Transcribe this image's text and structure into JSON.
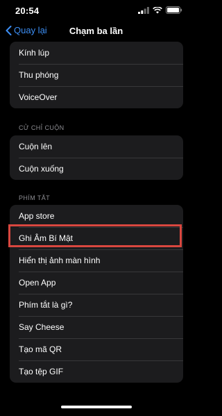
{
  "status_bar": {
    "time": "20:54"
  },
  "nav": {
    "back_label": "Quay lại",
    "title": "Chạm ba lần"
  },
  "sections": {
    "top": {
      "items": [
        "Kính lúp",
        "Thu phóng",
        "VoiceOver"
      ]
    },
    "scroll": {
      "header": "CỬ CHỈ CUỘN",
      "items": [
        "Cuộn lên",
        "Cuộn xuống"
      ]
    },
    "shortcuts": {
      "header": "PHÍM TẮT",
      "items": [
        "App store",
        "Ghi Âm Bí Mật",
        "Hiển thị ảnh màn hình",
        "Open App",
        "Phím tắt là gì?",
        "Say Cheese",
        "Tạo mã QR",
        "Tạo tệp GIF"
      ]
    }
  },
  "colors": {
    "accent": "#3d8ff5",
    "highlight": "#d9473f",
    "cell_bg": "#1c1c1e",
    "section_header": "#8d8d92"
  }
}
